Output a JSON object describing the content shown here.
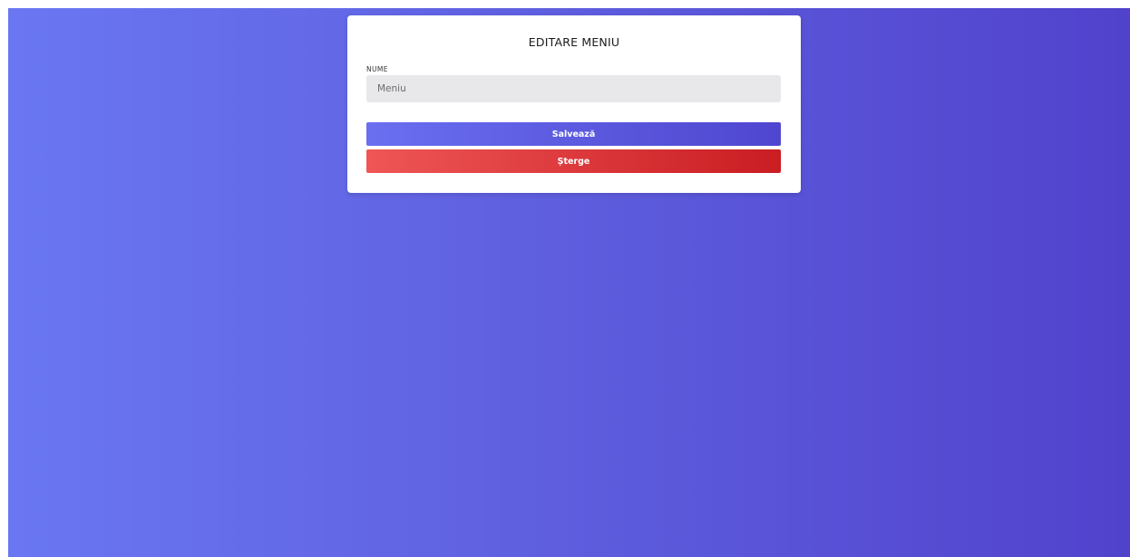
{
  "form": {
    "title": "EDITARE MENIU",
    "name_label": "NUME",
    "name_value": "Meniu",
    "name_placeholder": "Meniu"
  },
  "actions": {
    "save_label": "Salvează",
    "delete_label": "Șterge"
  },
  "colors": {
    "background_start": "#6a77f2",
    "background_end": "#5142cc",
    "save_start": "#6a6ff0",
    "save_end": "#4f46cf",
    "delete_start": "#ef5656",
    "delete_end": "#c91d22",
    "input_bg": "#e8e8ea"
  }
}
